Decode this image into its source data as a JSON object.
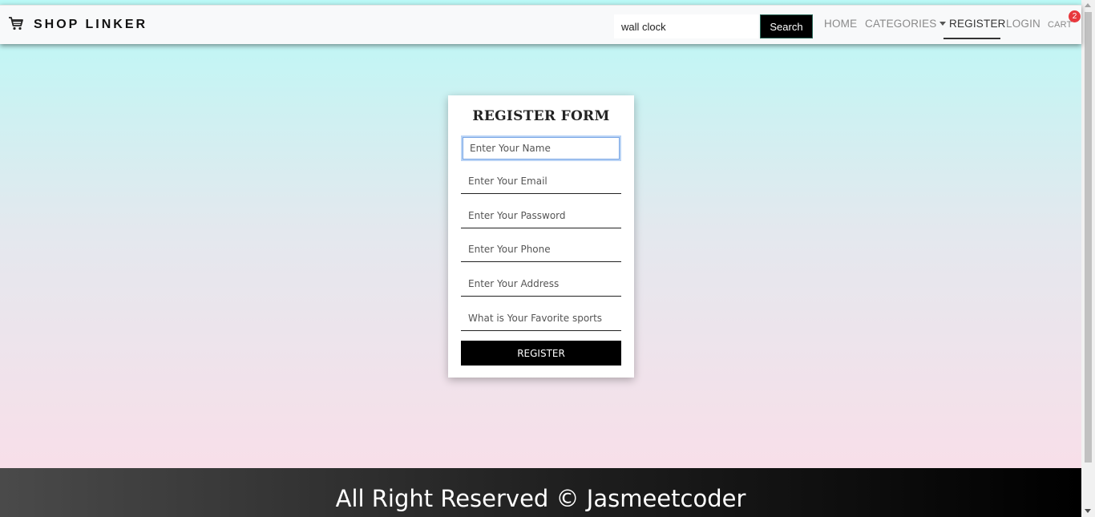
{
  "navbar": {
    "brand": "SHOP LINKER",
    "brand_icon": "shopping-cart-icon",
    "search": {
      "value": "wall clock",
      "button_label": "Search"
    },
    "links": {
      "home": "HOME",
      "categories": "CATEGORIES",
      "register": "REGISTER",
      "login": "LOGIN",
      "cart": "CART"
    },
    "cart_count": "2",
    "active_link": "register"
  },
  "form": {
    "title": "REGISTER FORM",
    "fields": {
      "name": "Enter Your Name",
      "email": "Enter Your Email",
      "password": "Enter Your Password",
      "phone": "Enter Your Phone",
      "address": "Enter Your Address",
      "sports": "What is Your Favorite sports"
    },
    "submit_label": "REGISTER"
  },
  "footer": {
    "text": "All Right Reserved © Jasmeetcoder"
  },
  "colors": {
    "badge": "#e8383d",
    "button": "#000000",
    "gradient_top": "#baf9f6",
    "gradient_bottom": "#fcdde8"
  }
}
